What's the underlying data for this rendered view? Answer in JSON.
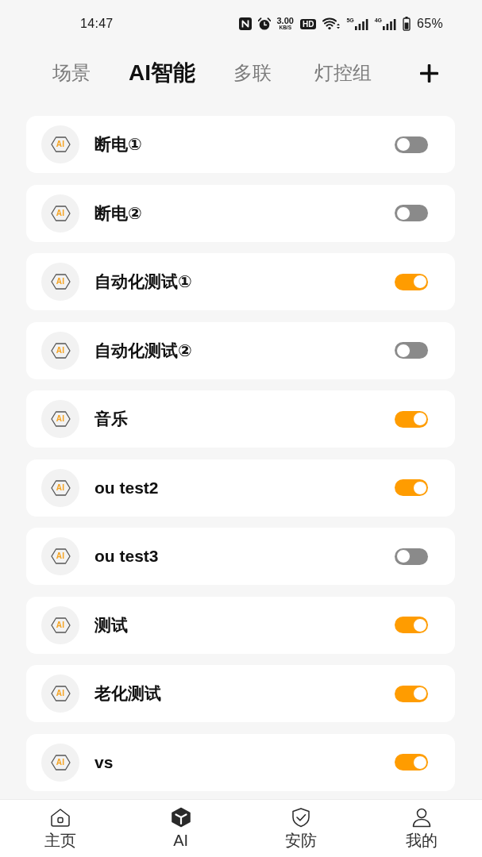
{
  "status_bar": {
    "time": "14:47",
    "speed_value": "3.00",
    "speed_unit": "KB/S",
    "hd_label": "HD",
    "networks": [
      {
        "label": "5G"
      },
      {
        "label": "4G"
      }
    ],
    "battery": "65%"
  },
  "tabs": [
    {
      "label": "场景",
      "selected": false
    },
    {
      "label": "AI智能",
      "selected": true
    },
    {
      "label": "多联",
      "selected": false
    },
    {
      "label": "灯控组",
      "selected": false
    }
  ],
  "scenes": [
    {
      "icon_label": "AI",
      "name": "断电①",
      "on": false
    },
    {
      "icon_label": "AI",
      "name": "断电②",
      "on": false
    },
    {
      "icon_label": "AI",
      "name": "自动化测试①",
      "on": true
    },
    {
      "icon_label": "AI",
      "name": "自动化测试②",
      "on": false
    },
    {
      "icon_label": "AI",
      "name": "音乐",
      "on": true
    },
    {
      "icon_label": "AI",
      "name": "ou test2",
      "on": true
    },
    {
      "icon_label": "AI",
      "name": "ou test3",
      "on": false
    },
    {
      "icon_label": "AI",
      "name": "测试",
      "on": true
    },
    {
      "icon_label": "AI",
      "name": "老化测试",
      "on": true
    },
    {
      "icon_label": "AI",
      "name": "vs",
      "on": true
    }
  ],
  "bottom_nav": [
    {
      "kind": "home",
      "label": "主页",
      "selected": false
    },
    {
      "kind": "cube",
      "label": "AI",
      "selected": true
    },
    {
      "kind": "shield",
      "label": "安防",
      "selected": false
    },
    {
      "kind": "person",
      "label": "我的",
      "selected": false
    }
  ]
}
